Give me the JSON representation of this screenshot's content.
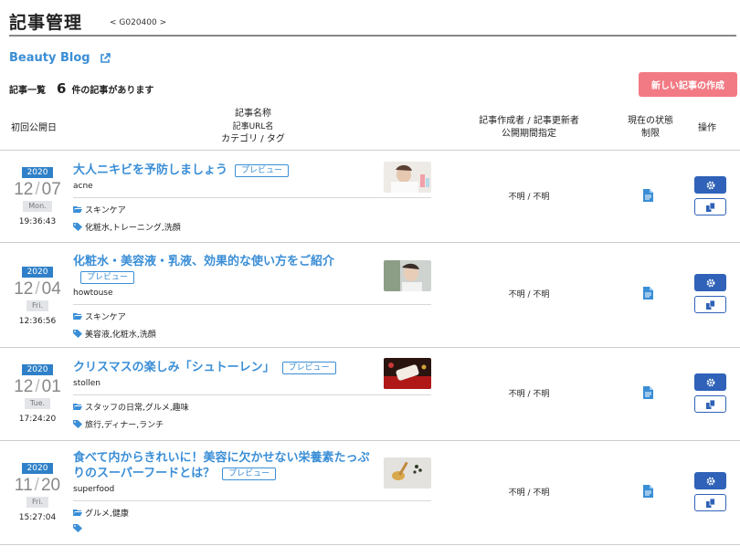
{
  "header": {
    "title": "記事管理",
    "code": "< G020400 >"
  },
  "blog": {
    "name": "Beauty Blog",
    "icon": "external-link-icon"
  },
  "list": {
    "label": "記事一覧",
    "count": "6",
    "count_suffix": "件の記事があります"
  },
  "actions": {
    "create_label": "新しい記事の作成"
  },
  "columns": {
    "first_published": "初回公開日",
    "article_line1": "記事名称",
    "article_line2": "記事URL名",
    "article_line3": "カテゴリ / タグ",
    "author_line1": "記事作成者 / 記事更新者",
    "author_line2": "公開期間指定",
    "status_line1": "現在の状態",
    "status_line2": "制限",
    "operations": "操作"
  },
  "colors": {
    "link": "#3a8ed6",
    "year_badge": "#2f80c8",
    "create_button": "#f27a84",
    "action_button": "#2f62b8"
  },
  "icons": {
    "category": "folder-open-icon",
    "tag": "tag-icon",
    "status": "document-icon",
    "settings": "gear-icon",
    "copy": "copy-icon"
  },
  "articles": [
    {
      "year": "2020",
      "month": "12",
      "day": "07",
      "weekday": "Mon.",
      "time": "19:36:43",
      "title": "大人ニキビを予防しましょう",
      "preview_label": "プレビュー",
      "slug": "acne",
      "category": "スキンケア",
      "tags": "化粧水,トレーニング,洗顔",
      "author": "不明 / 不明"
    },
    {
      "year": "2020",
      "month": "12",
      "day": "04",
      "weekday": "Fri.",
      "time": "12:36:56",
      "title": "化粧水・美容液・乳液、効果的な使い方をご紹介",
      "preview_label": "プレビュー",
      "slug": "howtouse",
      "category": "スキンケア",
      "tags": "美容液,化粧水,洗顔",
      "author": "不明 / 不明"
    },
    {
      "year": "2020",
      "month": "12",
      "day": "01",
      "weekday": "Tue.",
      "time": "17:24:20",
      "title": "クリスマスの楽しみ「シュトーレン」",
      "preview_label": "プレビュー",
      "slug": "stollen",
      "category": "スタッフの日常,グルメ,趣味",
      "tags": "旅行,ディナー,ランチ",
      "author": "不明 / 不明"
    },
    {
      "year": "2020",
      "month": "11",
      "day": "20",
      "weekday": "Fri.",
      "time": "15:27:04",
      "title": "食べて内からきれいに！美容に欠かせない栄養素たっぷりのスーパーフードとは？",
      "preview_label": "プレビュー",
      "slug": "superfood",
      "category": "グルメ,健康",
      "tags": "",
      "author": "不明 / 不明"
    }
  ]
}
